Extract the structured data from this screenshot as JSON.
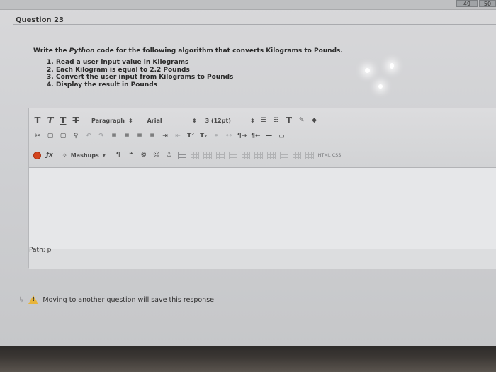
{
  "header": {
    "question_title": "Question 23",
    "score": "50",
    "points": "49"
  },
  "question": {
    "prompt_prefix": "Write the ",
    "prompt_italic": "Python",
    "prompt_suffix": " code for the following algorithm that converts Kilograms to Pounds.",
    "steps": [
      {
        "num": "1.",
        "text": "Read a user input value in Kilograms"
      },
      {
        "num": "2.",
        "text": "Each Kilogram is equal to 2.2 Pounds"
      },
      {
        "num": "3.",
        "text": "Convert the user input from Kilograms to Pounds"
      },
      {
        "num": "4.",
        "text": "Display the result in Pounds"
      }
    ]
  },
  "editor": {
    "format_select": "Paragraph",
    "font_select": "Arial",
    "size_select": "3 (12pt)",
    "mashups_label": "Mashups",
    "html_css_label": "HTML CSS",
    "path_label": "Path: p",
    "buttons": {
      "bold": "T",
      "italic": "T",
      "underline": "T",
      "strike": "T",
      "cut": "✂",
      "copy": "▢",
      "paste": "▢",
      "find": "⚲",
      "undo": "↶",
      "redo": "↷",
      "superscript": "T²",
      "subscript": "T₂",
      "pilcrow": "¶",
      "quote": "❝",
      "anchor": "⚓",
      "text_color": "T",
      "bullets": "☰",
      "numbered": "☷",
      "dash": "—"
    }
  },
  "footer": {
    "notice": "Moving to another question will save this response."
  }
}
